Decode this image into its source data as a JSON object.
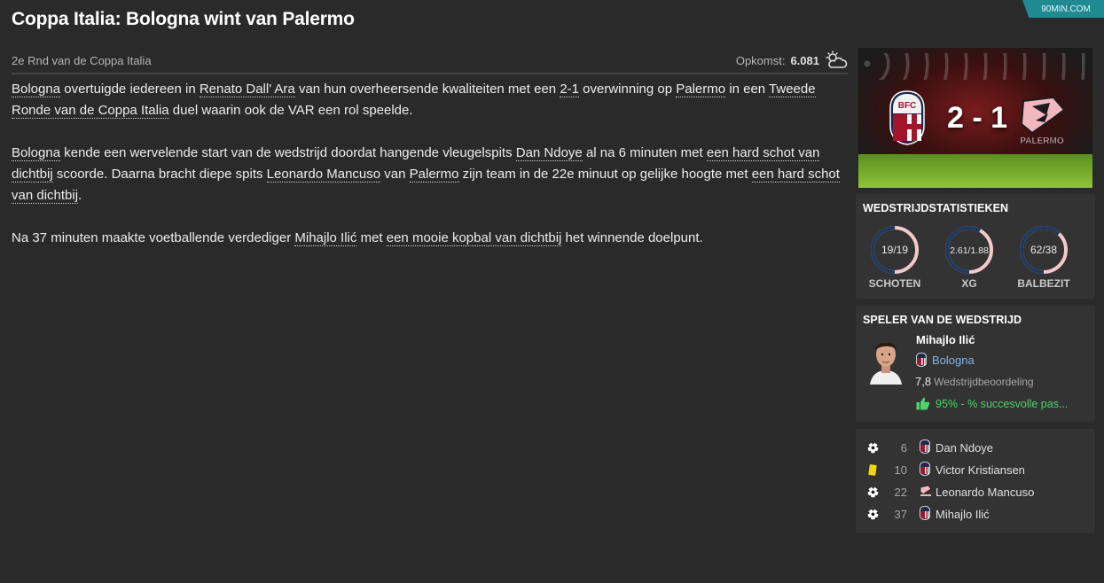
{
  "headline": "Coppa Italia: Bologna wint van Palermo",
  "source": "90MIN.COM",
  "meta": {
    "round": "2e Rnd van de Coppa Italia",
    "attendance_label": "Opkomst:",
    "attendance_value": "6.081",
    "weather_icon": "partly-cloudy-icon"
  },
  "article": {
    "p1": {
      "team_home": "Bologna",
      "t1": " overtuigde iedereen in ",
      "stadium": "Renato Dall' Ara",
      "t2": " van hun overheersende kwaliteiten met een ",
      "score": "2-1",
      "t3": " overwinning op ",
      "team_away": "Palermo",
      "t4": " in een ",
      "competition": "Tweede Ronde van de Coppa Italia",
      "t5": " duel waarin ook de VAR een rol speelde."
    },
    "p2": {
      "team_home": "Bologna",
      "t1": " kende een wervelende start van de wedstrijd doordat hangende vleugelspits ",
      "player1": "Dan Ndoye",
      "t2": " al na 6 minuten met ",
      "shot1": "een hard schot van dichtbij",
      "t3": " scoorde. Daarna bracht diepe spits ",
      "player2": "Leonardo Mancuso",
      "t4": " van ",
      "team_away": "Palermo",
      "t5": " zijn team in de 22e minuut op gelijke hoogte met ",
      "shot2": "een hard schot van dichtbij",
      "t6": "."
    },
    "p3": {
      "t1": "Na 37 minuten maakte voetballende verdediger ",
      "player": "Mihajlo Ilić",
      "t2": " met ",
      "header": "een mooie kopbal van dichtbij",
      "t3": " het winnende doelpunt."
    }
  },
  "score_card": {
    "home_goals": "2",
    "separator": "-",
    "away_goals": "1",
    "away_crest_text": "PALERMO",
    "home_crest_text": "BFC"
  },
  "stats": {
    "title": "WEDSTRIJDSTATISTIEKEN",
    "items": [
      {
        "value": "19/19",
        "label": "SCHOTEN",
        "home_share": 0.5
      },
      {
        "value": "2.61/1.88",
        "label": "XG",
        "home_share": 0.58
      },
      {
        "value": "62/38",
        "label": "BALBEZIT",
        "home_share": 0.62
      }
    ],
    "colors": {
      "home": "#1f3a5f",
      "away": "#f3c9cc"
    }
  },
  "motm": {
    "title": "SPELER VAN DE WEDSTRIJD",
    "name": "Mihajlo Ilić",
    "club": "Bologna",
    "rating": "7,8",
    "rating_label": "Wedstrijdbeoordeling",
    "stat": "95% - % succesvolle pas..."
  },
  "events": [
    {
      "icon": "ball-icon",
      "minute": "6",
      "team": "bologna",
      "player": "Dan Ndoye"
    },
    {
      "icon": "yellow-card-icon",
      "minute": "10",
      "team": "bologna",
      "player": "Victor Kristiansen"
    },
    {
      "icon": "ball-icon",
      "minute": "22",
      "team": "palermo",
      "player": "Leonardo Mancuso"
    },
    {
      "icon": "ball-icon",
      "minute": "37",
      "team": "bologna",
      "player": "Mihajlo Ilić"
    }
  ]
}
